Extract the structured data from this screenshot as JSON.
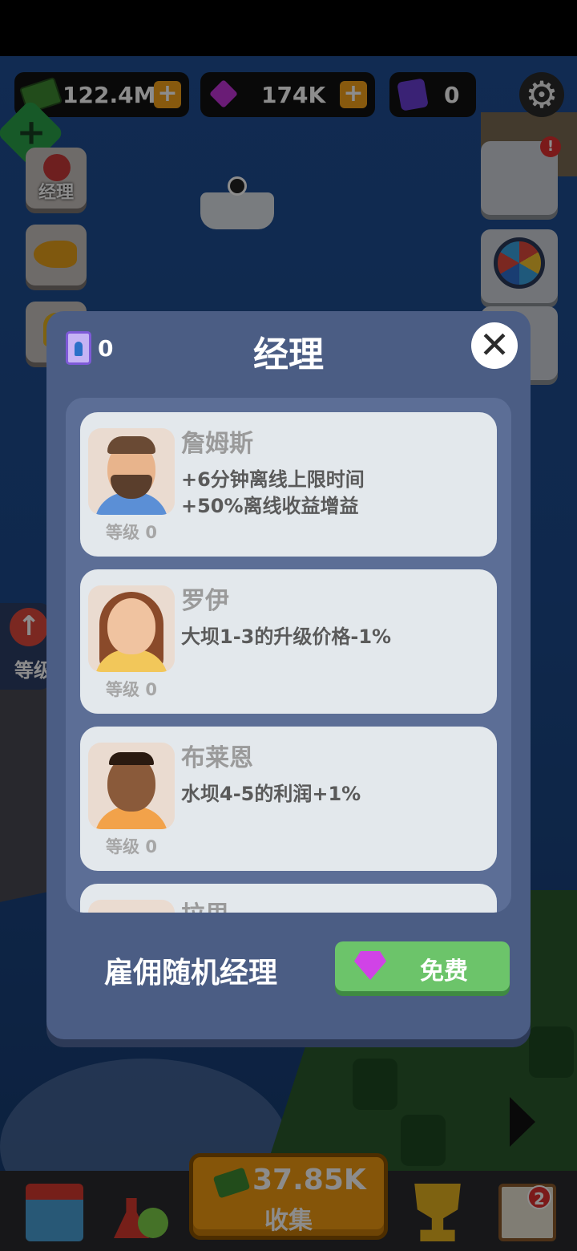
{
  "hud": {
    "cash": "122.4M",
    "gems": "174K",
    "cards": "0",
    "plus": "+"
  },
  "side_menu": {
    "manager_label": "经理",
    "upgrade_label": "等级"
  },
  "modal": {
    "title": "经理",
    "card_count": "0",
    "close_symbol": "✕",
    "managers": [
      {
        "name": "詹姆斯",
        "desc": "+6分钟离线上限时间\n+50%离线收益增益",
        "level": "等级 0"
      },
      {
        "name": "罗伊",
        "desc": "大坝1-3的升级价格-1%",
        "level": "等级 0"
      },
      {
        "name": "布莱恩",
        "desc": "水坝4-5的利润+1%",
        "level": "等级 0"
      },
      {
        "name": "拉里",
        "desc": "",
        "level": ""
      }
    ],
    "hire_label": "雇佣随机经理",
    "hire_button": "免费"
  },
  "bottom": {
    "collect_amount": "37.85K",
    "collect_label": "收集",
    "tasks_badge": "2",
    "alert_badge": "!"
  },
  "colors": {
    "modal_bg": "#4b5d84",
    "card_bg": "#e3e8ec",
    "hire_green": "#6cc46a",
    "hud_plus": "#f6a31b"
  },
  "icons": [
    "cash-icon",
    "gem-icon",
    "card-icon",
    "gear-icon",
    "close-icon",
    "fish-icon",
    "wheel-icon",
    "shop-icon",
    "lab-icon",
    "trophy-icon",
    "tasks-icon"
  ]
}
